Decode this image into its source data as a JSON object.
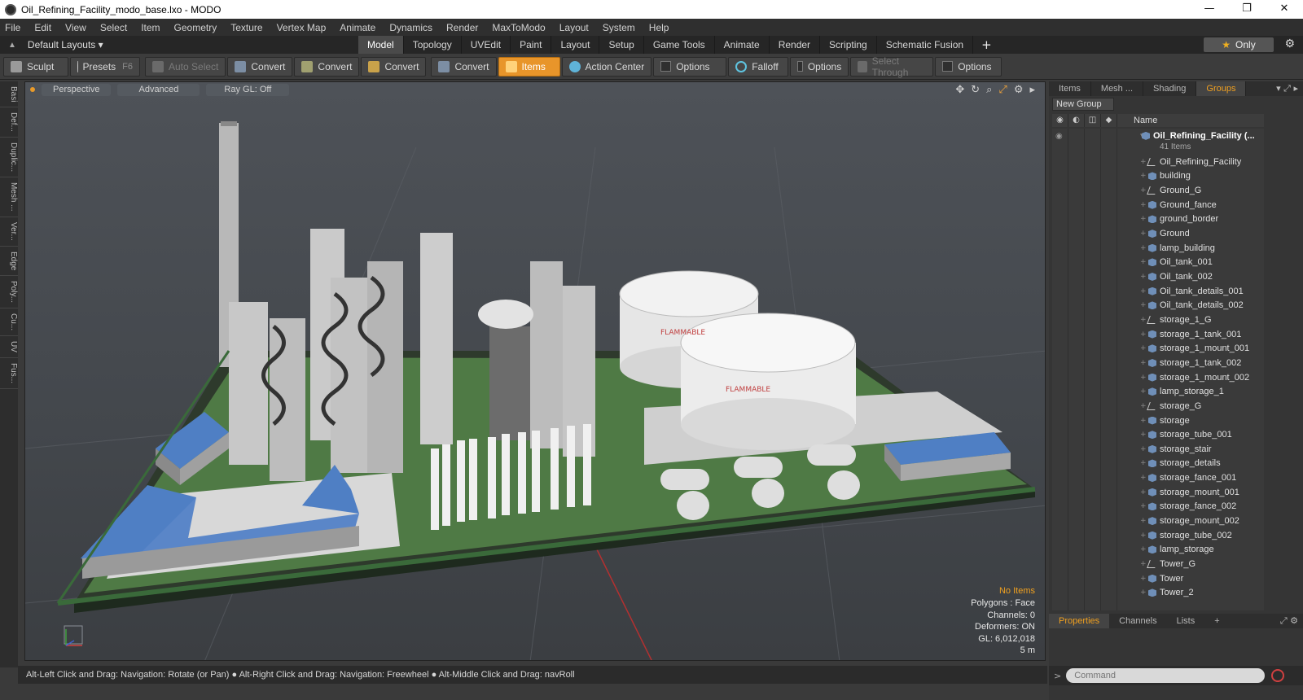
{
  "window": {
    "title": "Oil_Refining_Facility_modo_base.lxo - MODO",
    "controls": [
      "—",
      "❐",
      "✕"
    ]
  },
  "menu": [
    "File",
    "Edit",
    "View",
    "Select",
    "Item",
    "Geometry",
    "Texture",
    "Vertex Map",
    "Animate",
    "Dynamics",
    "Render",
    "MaxToModo",
    "Layout",
    "System",
    "Help"
  ],
  "layouts": {
    "label": "Default Layouts ▾"
  },
  "tabs": [
    "Model",
    "Topology",
    "UVEdit",
    "Paint",
    "Layout",
    "Setup",
    "Game Tools",
    "Animate",
    "Render",
    "Scripting",
    "Schematic Fusion"
  ],
  "tabs_active": "Model",
  "only_label": "Only",
  "toolbar": {
    "sculpt": "Sculpt",
    "presets": "Presets",
    "presets_key": "F6",
    "auto_select": "Auto Select",
    "convert1": "Convert",
    "convert2": "Convert",
    "convert3": "Convert",
    "convert4": "Convert",
    "items": "Items",
    "action_center": "Action Center",
    "options1": "Options",
    "falloff": "Falloff",
    "options2": "Options",
    "select_through": "Select Through",
    "options3": "Options"
  },
  "left_tabs": [
    "Basi",
    "Def...",
    "Duplic...",
    "Mesh ...",
    "Ver...",
    "Edge",
    "Poly...",
    "Cu...",
    "UV",
    "Fus..."
  ],
  "viewport": {
    "view": "Perspective",
    "shading": "Advanced",
    "raygl": "Ray GL: Off",
    "stats": {
      "no_items": "No Items",
      "polygons": "Polygons : Face",
      "channels": "Channels: 0",
      "deformers": "Deformers: ON",
      "gl": "GL: 6,012,018",
      "scale": "5 m"
    },
    "tank_label": "FLAMMABLE"
  },
  "status": "Alt-Left Click and Drag: Navigation: Rotate (or Pan) ● Alt-Right Click and Drag: Navigation: Freewheel ● Alt-Middle Click and Drag: navRoll",
  "right_panel": {
    "tabs": [
      "Items",
      "Mesh ...",
      "Shading",
      "Groups"
    ],
    "active_tab": "Groups",
    "new_group": "New Group",
    "column_name": "Name",
    "root": {
      "label": "Oil_Refining_Facility (...",
      "count": "41 Items"
    },
    "items": [
      {
        "label": "Oil_Refining_Facility",
        "type": "grp"
      },
      {
        "label": "building",
        "type": "mesh"
      },
      {
        "label": "Ground_G",
        "type": "grp"
      },
      {
        "label": "Ground_fance",
        "type": "mesh"
      },
      {
        "label": "ground_border",
        "type": "mesh"
      },
      {
        "label": "Ground",
        "type": "mesh"
      },
      {
        "label": "lamp_building",
        "type": "mesh"
      },
      {
        "label": "Oil_tank_001",
        "type": "mesh"
      },
      {
        "label": "Oil_tank_002",
        "type": "mesh"
      },
      {
        "label": "Oil_tank_details_001",
        "type": "mesh"
      },
      {
        "label": "Oil_tank_details_002",
        "type": "mesh"
      },
      {
        "label": "storage_1_G",
        "type": "grp"
      },
      {
        "label": "storage_1_tank_001",
        "type": "mesh"
      },
      {
        "label": "storage_1_mount_001",
        "type": "mesh"
      },
      {
        "label": "storage_1_tank_002",
        "type": "mesh"
      },
      {
        "label": "storage_1_mount_002",
        "type": "mesh"
      },
      {
        "label": "lamp_storage_1",
        "type": "mesh"
      },
      {
        "label": "storage_G",
        "type": "grp"
      },
      {
        "label": "storage",
        "type": "mesh"
      },
      {
        "label": "storage_tube_001",
        "type": "mesh"
      },
      {
        "label": "storage_stair",
        "type": "mesh"
      },
      {
        "label": "storage_details",
        "type": "mesh"
      },
      {
        "label": "storage_fance_001",
        "type": "mesh"
      },
      {
        "label": "storage_mount_001",
        "type": "mesh"
      },
      {
        "label": "storage_fance_002",
        "type": "mesh"
      },
      {
        "label": "storage_mount_002",
        "type": "mesh"
      },
      {
        "label": "storage_tube_002",
        "type": "mesh"
      },
      {
        "label": "lamp_storage",
        "type": "mesh"
      },
      {
        "label": "Tower_G",
        "type": "grp"
      },
      {
        "label": "Tower",
        "type": "mesh"
      },
      {
        "label": "Tower_2",
        "type": "mesh"
      }
    ],
    "bottom_tabs": [
      "Properties",
      "Channels",
      "Lists"
    ],
    "bottom_active": "Properties",
    "command_placeholder": "Command"
  },
  "colors": {
    "accent": "#e8952a",
    "roof": "#4f7fc4",
    "ground": "#5a8a4a",
    "tank": "#e6e6e6"
  }
}
